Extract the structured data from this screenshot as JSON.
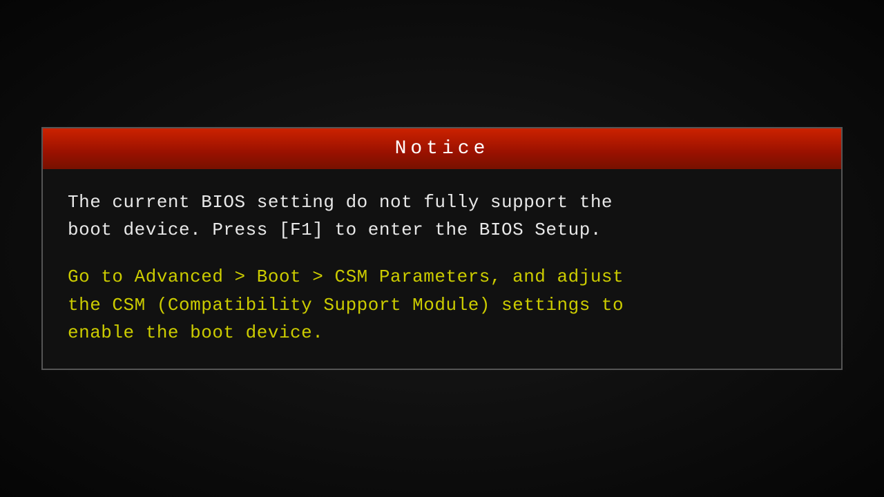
{
  "notice": {
    "title": "Notice",
    "white_text_line1": "The current BIOS setting do not fully support the",
    "white_text_line2": "boot device. Press [F1] to enter the BIOS Setup.",
    "yellow_text_line1": "Go to Advanced > Boot > CSM Parameters, and adjust",
    "yellow_text_line2": "the CSM (Compatibility Support Module) settings to",
    "yellow_text_line3": "enable the boot device."
  }
}
